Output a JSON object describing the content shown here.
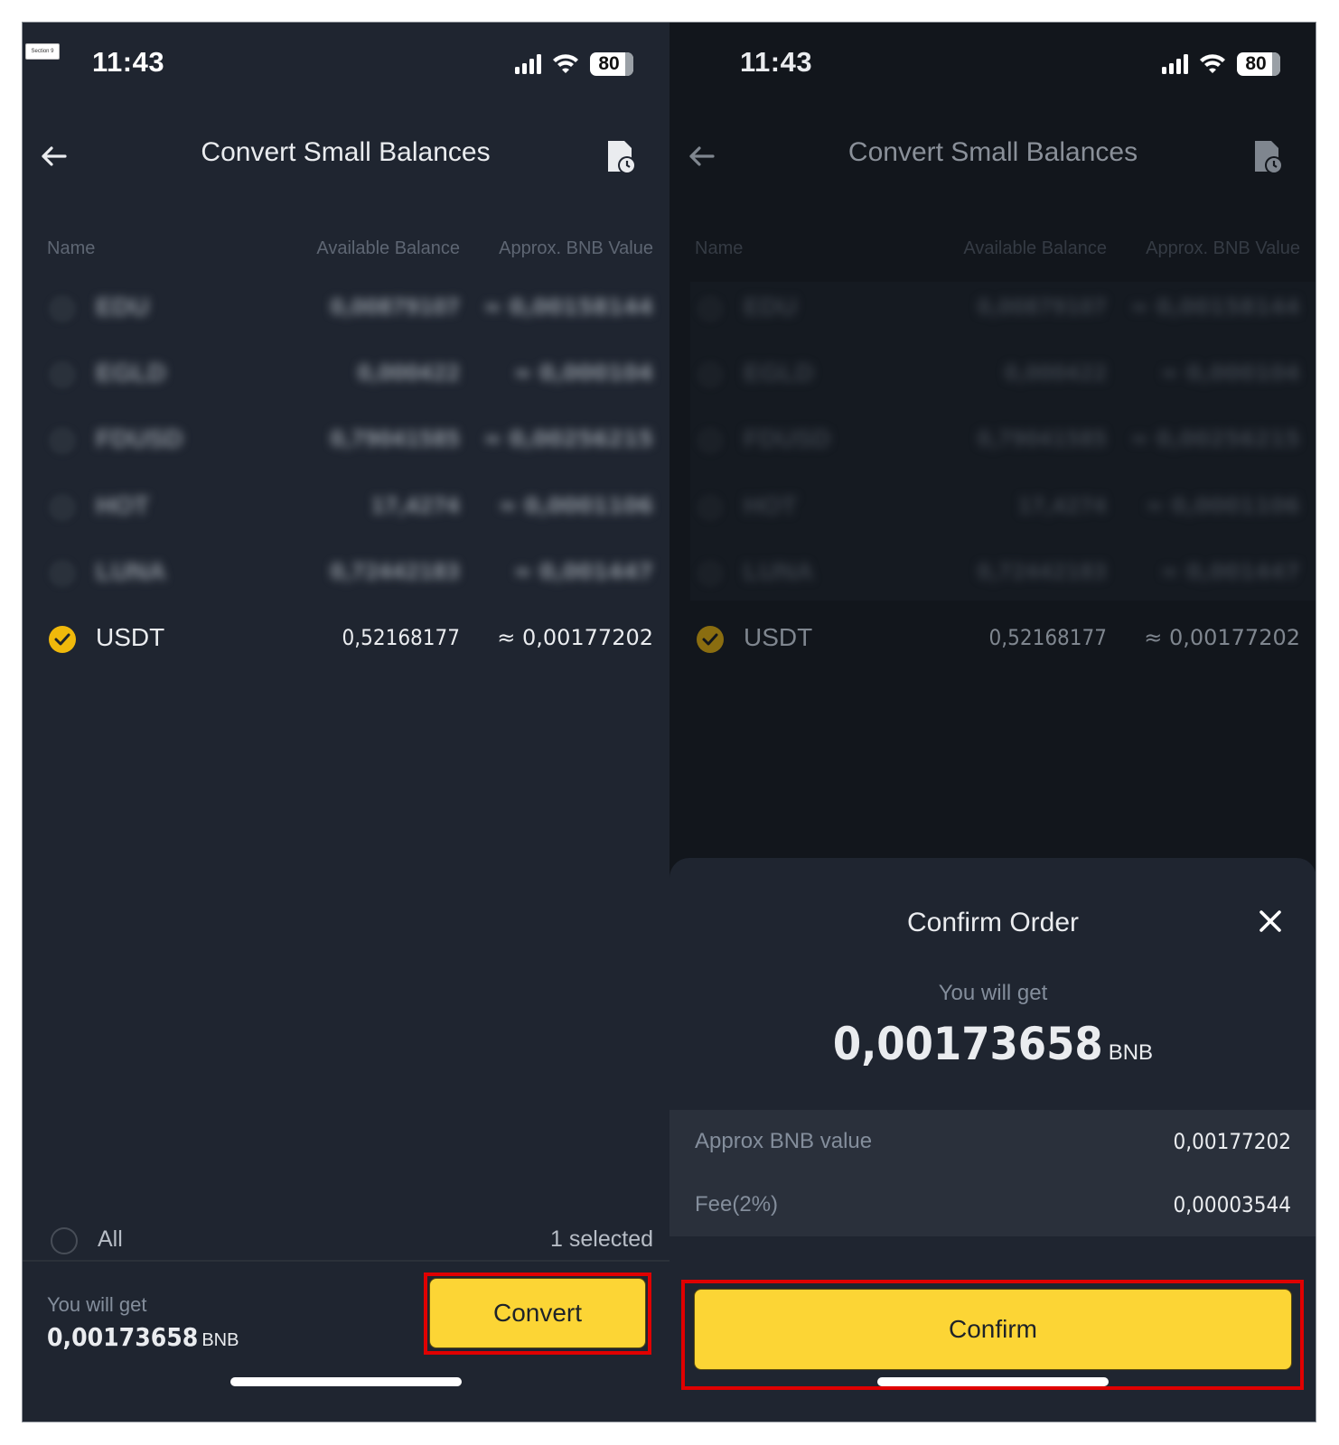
{
  "annotation": {
    "section_tag": "Section 9"
  },
  "status_bar": {
    "time": "11:43",
    "battery": "80",
    "signal_icon": "cellular-signal-icon",
    "wifi_icon": "wifi-icon",
    "battery_icon": "battery-icon"
  },
  "header": {
    "title": "Convert Small Balances",
    "back_icon": "arrow-left-icon",
    "history_icon": "document-history-icon"
  },
  "table": {
    "columns": [
      "Name",
      "Available Balance",
      "Approx. BNB Value"
    ],
    "rows": [
      {
        "coin": "EDU",
        "balance": "0,00879107",
        "bnb_value": "≈ 0,00158144",
        "selected": false,
        "obscured": true
      },
      {
        "coin": "EGLD",
        "balance": "0,000422",
        "bnb_value": "≈ 0,000104",
        "selected": false,
        "obscured": true
      },
      {
        "coin": "FDUSD",
        "balance": "0,79041585",
        "bnb_value": "≈ 0,00256215",
        "selected": false,
        "obscured": true
      },
      {
        "coin": "HOT",
        "balance": "17,4274",
        "bnb_value": "≈ 0,0001106",
        "selected": false,
        "obscured": true
      },
      {
        "coin": "LUNA",
        "balance": "0,72442183",
        "bnb_value": "≈ 0,001447",
        "selected": false,
        "obscured": true
      },
      {
        "coin": "USDT",
        "balance": "0,52168177",
        "bnb_value": "≈ 0,00177202",
        "selected": true,
        "obscured": false
      }
    ]
  },
  "footer": {
    "all_label": "All",
    "selected_count": "1 selected",
    "you_will_get_label": "You will get",
    "you_will_get_amount": "0,00173658",
    "you_will_get_unit": "BNB",
    "convert_button": "Convert"
  },
  "confirm_sheet": {
    "title": "Confirm Order",
    "close_icon": "close-icon",
    "you_will_get_label": "You will get",
    "amount": "0,00173658",
    "unit": "BNB",
    "details": [
      {
        "label": "Approx BNB value",
        "value": "0,00177202"
      },
      {
        "label": "Fee(2%)",
        "value": "0,00003544"
      }
    ],
    "confirm_button": "Confirm"
  },
  "colors": {
    "accent_yellow": "#fcd535",
    "check_yellow": "#f0b90b",
    "highlight_red": "#e00000",
    "background": "#1f2530"
  }
}
